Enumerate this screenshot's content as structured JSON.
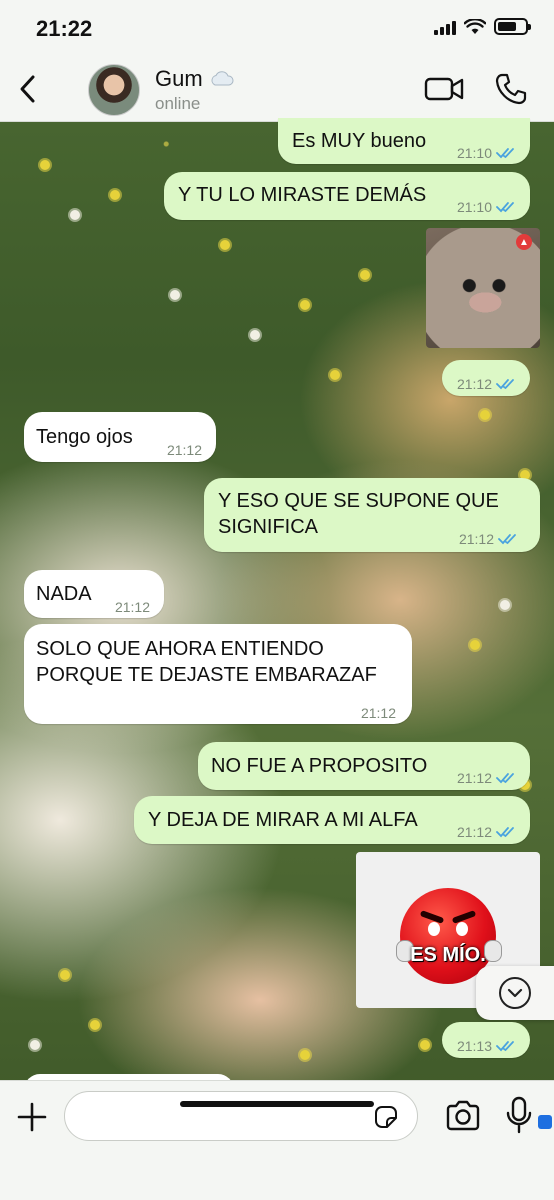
{
  "status_bar": {
    "time": "21:22"
  },
  "header": {
    "contact_name": "Gum",
    "contact_status": "online",
    "icons": [
      "back-arrow-icon",
      "cloud-icon",
      "video-camera-icon",
      "phone-icon"
    ]
  },
  "messages": [
    {
      "id": 1,
      "side": "out",
      "text": "Es MUY bueno",
      "time": "21:10"
    },
    {
      "id": 2,
      "side": "out",
      "text": "Y TU LO MIRASTE DEMÁS",
      "time": "21:10"
    },
    {
      "id": 3,
      "side": "out",
      "type": "sticker",
      "sticker": "kitten-sticker",
      "time": "21:12"
    },
    {
      "id": 4,
      "side": "in",
      "text": "Tengo ojos",
      "time": "21:12"
    },
    {
      "id": 5,
      "side": "out",
      "line1": "Y ESO QUE SE SUPONE QUE",
      "line2": "SIGNIFICA",
      "time": "21:12"
    },
    {
      "id": 6,
      "side": "in",
      "text": "NADA",
      "time": "21:12"
    },
    {
      "id": 7,
      "side": "in",
      "line1": "SOLO QUE AHORA ENTIENDO",
      "line2": "PORQUE TE DEJASTE EMBARAZAF",
      "time": "21:12"
    },
    {
      "id": 8,
      "side": "out",
      "text": "NO FUE A PROPOSITO",
      "time": "21:12"
    },
    {
      "id": 9,
      "side": "out",
      "text": "Y DEJA DE MIRAR A MI ALFA",
      "time": "21:12"
    },
    {
      "id": 10,
      "side": "out",
      "type": "sticker",
      "sticker": "angry-emoji-sticker",
      "sticker_text": "ES MÍO.",
      "time": "21:13"
    }
  ],
  "composer": {
    "input_value": "",
    "icons": [
      "plus-icon",
      "sticker-icon",
      "camera-icon",
      "microphone-icon"
    ]
  },
  "colors": {
    "outgoing_bubble": "#dcf8c6",
    "incoming_bubble": "#ffffff",
    "read_ticks": "#4aa3df"
  }
}
